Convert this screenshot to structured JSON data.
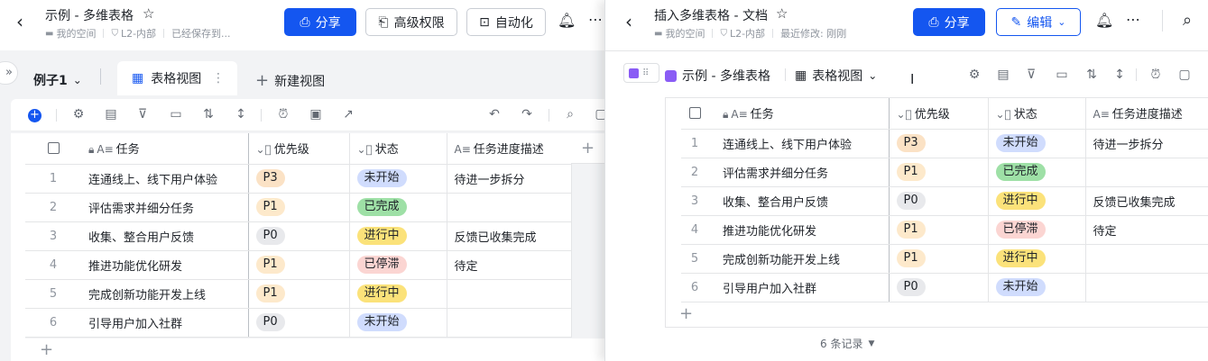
{
  "left": {
    "title": "示例 - 多维表格",
    "breadcrumb": {
      "space": "我的空间",
      "security": "L2-内部",
      "status": "已经保存到..."
    },
    "buttons": {
      "share": "分享",
      "permissions": "高级权限",
      "automation": "自动化"
    },
    "tabs": {
      "table_name": "例子1",
      "view": "表格视图",
      "new_view": "新建视图"
    },
    "columns": [
      "任务",
      "优先级",
      "状态",
      "任务进度描述"
    ],
    "rows": [
      {
        "num": "1",
        "task": "连通线上、线下用户体验",
        "priority": "P3",
        "status": "未开始",
        "desc": "待进一步拆分"
      },
      {
        "num": "2",
        "task": "评估需求并细分任务",
        "priority": "P1",
        "status": "已完成",
        "desc": ""
      },
      {
        "num": "3",
        "task": "收集、整合用户反馈",
        "priority": "P0",
        "status": "进行中",
        "desc": "反馈已收集完成"
      },
      {
        "num": "4",
        "task": "推进功能优化研发",
        "priority": "P1",
        "status": "已停滞",
        "desc": "待定"
      },
      {
        "num": "5",
        "task": "完成创新功能开发上线",
        "priority": "P1",
        "status": "进行中",
        "desc": ""
      },
      {
        "num": "6",
        "task": "引导用户加入社群",
        "priority": "P0",
        "status": "未开始",
        "desc": ""
      }
    ],
    "add_symbol": "+"
  },
  "right": {
    "title": "插入多维表格 - 文档",
    "breadcrumb": {
      "space": "我的空间",
      "security": "L2-内部",
      "modified": "最近修改: 刚刚"
    },
    "buttons": {
      "share": "分享",
      "edit": "编辑"
    },
    "embed": {
      "name": "示例 - 多维表格",
      "view": "表格视图"
    },
    "columns": [
      "任务",
      "优先级",
      "状态",
      "任务进度描述"
    ],
    "rows": [
      {
        "num": "1",
        "task": "连通线上、线下用户体验",
        "priority": "P3",
        "status": "未开始",
        "desc": "待进一步拆分"
      },
      {
        "num": "2",
        "task": "评估需求并细分任务",
        "priority": "P1",
        "status": "已完成",
        "desc": ""
      },
      {
        "num": "3",
        "task": "收集、整合用户反馈",
        "priority": "P0",
        "status": "进行中",
        "desc": "反馈已收集完成"
      },
      {
        "num": "4",
        "task": "推进功能优化研发",
        "priority": "P1",
        "status": "已停滞",
        "desc": "待定"
      },
      {
        "num": "5",
        "task": "完成创新功能开发上线",
        "priority": "P1",
        "status": "进行中",
        "desc": ""
      },
      {
        "num": "6",
        "task": "引导用户加入社群",
        "priority": "P0",
        "status": "未开始",
        "desc": ""
      }
    ],
    "record_count": "6 条记录"
  },
  "colors": {
    "accent": "#1456f0",
    "p3": "#fbe2c5",
    "p1": "#fde9cb",
    "p0": "#e8e9ec",
    "todo": "#d0dcfd",
    "done": "#9ee0a6",
    "progress": "#fbe27a",
    "stalled": "#fbd5d2"
  },
  "icons": [
    "back-icon",
    "star-icon",
    "folder-icon",
    "shield-icon",
    "share-icon",
    "permission-icon",
    "robot-icon",
    "bell-icon",
    "more-icon",
    "search-icon",
    "expand-icon",
    "chevron-down-icon",
    "grid-view-icon",
    "plus-icon",
    "settings-icon",
    "form-icon",
    "filter-icon",
    "group-icon",
    "sort-icon",
    "row-height-icon",
    "alarm-icon",
    "comment-icon",
    "undo-icon",
    "redo-icon",
    "lock-icon",
    "text-field-icon",
    "single-select-icon",
    "edit-icon",
    "cursor-icon"
  ]
}
